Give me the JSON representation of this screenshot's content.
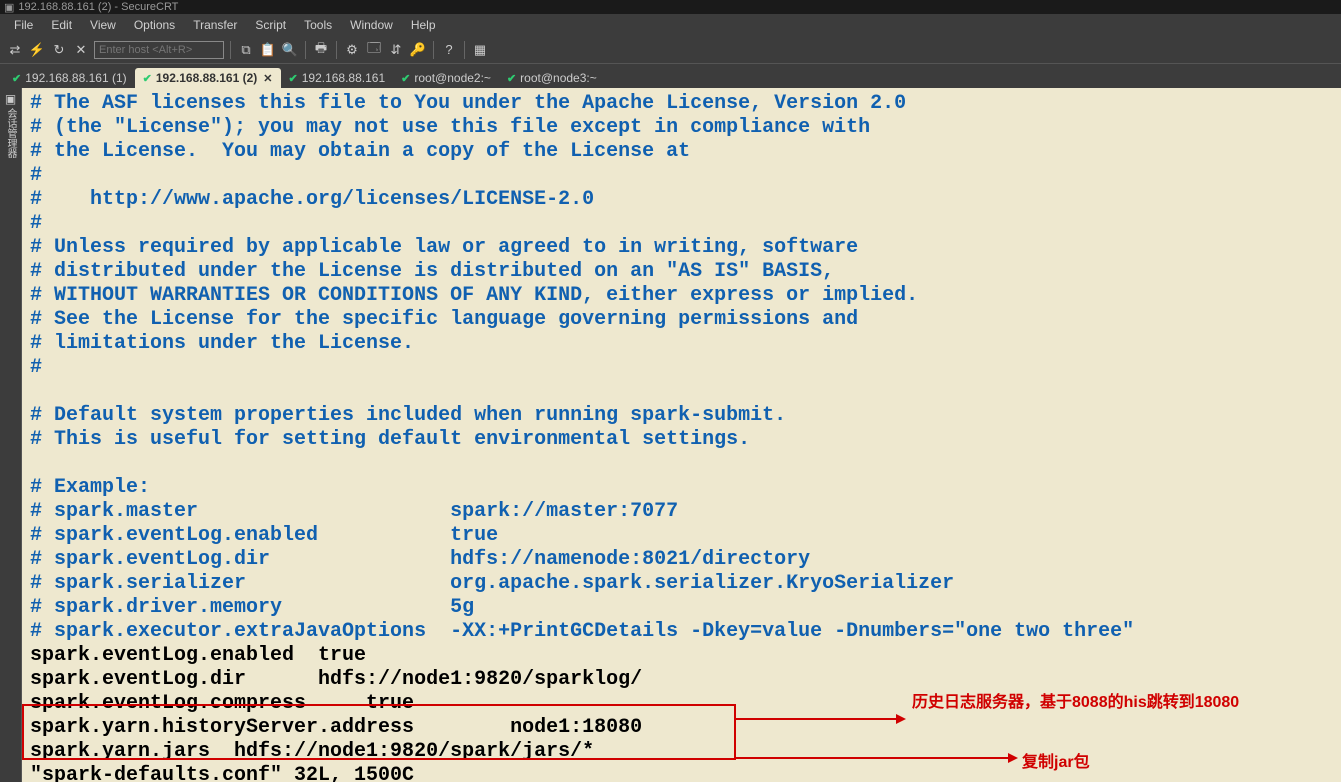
{
  "window": {
    "title": "192.168.88.161 (2) - SecureCRT"
  },
  "menu": [
    "File",
    "Edit",
    "View",
    "Options",
    "Transfer",
    "Script",
    "Tools",
    "Window",
    "Help"
  ],
  "toolbar": {
    "host_placeholder": "Enter host <Alt+R>"
  },
  "tabs": [
    {
      "label": "192.168.88.161 (1)",
      "active": false
    },
    {
      "label": "192.168.88.161 (2)",
      "active": true
    },
    {
      "label": "192.168.88.161",
      "active": false
    },
    {
      "label": "root@node2:~",
      "active": false
    },
    {
      "label": "root@node3:~",
      "active": false
    }
  ],
  "terminal": {
    "lines": [
      {
        "t": "cmnt",
        "s": "# The ASF licenses this file to You under the Apache License, Version 2.0"
      },
      {
        "t": "cmnt",
        "s": "# (the \"License\"); you may not use this file except in compliance with"
      },
      {
        "t": "cmnt",
        "s": "# the License.  You may obtain a copy of the License at"
      },
      {
        "t": "cmnt",
        "s": "#"
      },
      {
        "t": "cmnt",
        "s": "#    http://www.apache.org/licenses/LICENSE-2.0"
      },
      {
        "t": "cmnt",
        "s": "#"
      },
      {
        "t": "cmnt",
        "s": "# Unless required by applicable law or agreed to in writing, software"
      },
      {
        "t": "cmnt",
        "s": "# distributed under the License is distributed on an \"AS IS\" BASIS,"
      },
      {
        "t": "cmnt",
        "s": "# WITHOUT WARRANTIES OR CONDITIONS OF ANY KIND, either express or implied."
      },
      {
        "t": "cmnt",
        "s": "# See the License for the specific language governing permissions and"
      },
      {
        "t": "cmnt",
        "s": "# limitations under the License."
      },
      {
        "t": "cmnt",
        "s": "#"
      },
      {
        "t": "plain",
        "s": ""
      },
      {
        "t": "cmnt",
        "s": "# Default system properties included when running spark-submit."
      },
      {
        "t": "cmnt",
        "s": "# This is useful for setting default environmental settings."
      },
      {
        "t": "plain",
        "s": ""
      },
      {
        "t": "cmnt",
        "s": "# Example:"
      },
      {
        "t": "cmnt",
        "s": "# spark.master                     spark://master:7077"
      },
      {
        "t": "cmnt",
        "s": "# spark.eventLog.enabled           true"
      },
      {
        "t": "cmnt",
        "s": "# spark.eventLog.dir               hdfs://namenode:8021/directory"
      },
      {
        "t": "cmnt",
        "s": "# spark.serializer                 org.apache.spark.serializer.KryoSerializer"
      },
      {
        "t": "cmnt",
        "s": "# spark.driver.memory              5g"
      },
      {
        "t": "cmnt",
        "s": "# spark.executor.extraJavaOptions  -XX:+PrintGCDetails -Dkey=value -Dnumbers=\"one two three\""
      },
      {
        "t": "plain",
        "s": "spark.eventLog.enabled  true"
      },
      {
        "t": "plain",
        "s": "spark.eventLog.dir      hdfs://node1:9820/sparklog/"
      },
      {
        "t": "plain",
        "s": "spark.eventLog.compress     true"
      },
      {
        "t": "plain",
        "s": "spark.yarn.historyServer.address        node1:18080"
      },
      {
        "t": "plain",
        "s": "spark.yarn.jars  hdfs://node1:9820/spark/jars/*"
      },
      {
        "t": "plain",
        "s": "\"spark-defaults.conf\" 32L, 1500C"
      }
    ]
  },
  "annotations": {
    "a1": "历史日志服务器，基于8088的his跳转到18080",
    "a2": "复制jar包"
  }
}
